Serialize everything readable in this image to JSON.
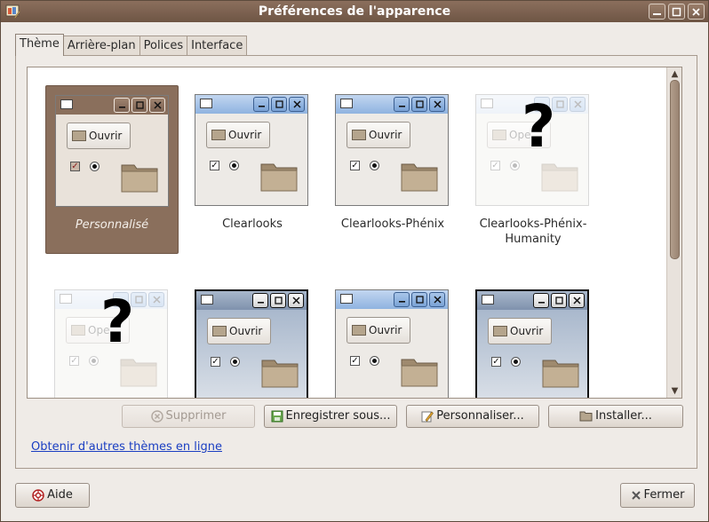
{
  "window": {
    "title": "Préférences de l'apparence"
  },
  "tabs": [
    {
      "label": "Thème",
      "active": true
    },
    {
      "label": "Arrière-plan",
      "active": false
    },
    {
      "label": "Polices",
      "active": false
    },
    {
      "label": "Interface",
      "active": false
    }
  ],
  "preview_text": {
    "open_label": "Ouvrir",
    "open_label_ghost": "Ope"
  },
  "themes": [
    {
      "name": "Personnalisé",
      "selected": true,
      "style": "custom"
    },
    {
      "name": "Clearlooks",
      "selected": false,
      "style": "clearlooks"
    },
    {
      "name": "Clearlooks-Phénix",
      "selected": false,
      "style": "clearlooks"
    },
    {
      "name": "Clearlooks-Phénix-Humanity",
      "selected": false,
      "style": "unknown"
    },
    {
      "name": "",
      "selected": false,
      "style": "unknown"
    },
    {
      "name": "",
      "selected": false,
      "style": "dark-blue"
    },
    {
      "name": "",
      "selected": false,
      "style": "clearlooks"
    },
    {
      "name": "",
      "selected": false,
      "style": "dark-blue"
    }
  ],
  "buttons": {
    "delete": "Supprimer",
    "save_as": "Enregistrer sous...",
    "customize": "Personnaliser...",
    "install": "Installer...",
    "help": "Aide",
    "close": "Fermer"
  },
  "link": {
    "online_themes": "Obtenir d'autres thèmes en ligne"
  },
  "colors": {
    "titlebar": "#7a604f",
    "selection": "#8a6f5c",
    "link": "#1a3ec2",
    "clearlooks_blue": "#7aa3d6"
  }
}
